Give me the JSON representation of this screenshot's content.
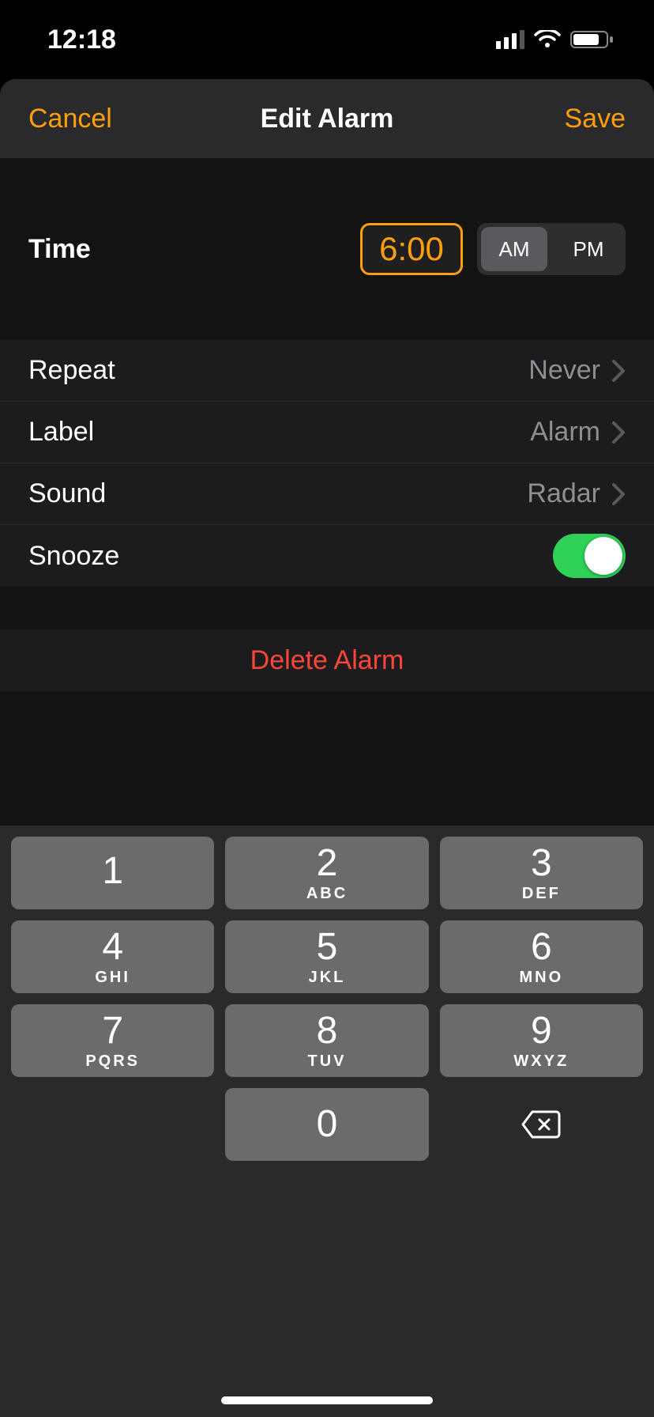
{
  "status": {
    "time": "12:18"
  },
  "nav": {
    "cancel": "Cancel",
    "title": "Edit Alarm",
    "save": "Save"
  },
  "time": {
    "label": "Time",
    "value": "6:00",
    "am": "AM",
    "pm": "PM",
    "selected": "AM"
  },
  "rows": {
    "repeat": {
      "label": "Repeat",
      "value": "Never"
    },
    "label": {
      "label": "Label",
      "value": "Alarm"
    },
    "sound": {
      "label": "Sound",
      "value": "Radar"
    },
    "snooze": {
      "label": "Snooze",
      "on": true
    }
  },
  "delete": {
    "label": "Delete Alarm"
  },
  "keypad": [
    {
      "d": "1",
      "l": " "
    },
    {
      "d": "2",
      "l": "ABC"
    },
    {
      "d": "3",
      "l": "DEF"
    },
    {
      "d": "4",
      "l": "GHI"
    },
    {
      "d": "5",
      "l": "JKL"
    },
    {
      "d": "6",
      "l": "MNO"
    },
    {
      "d": "7",
      "l": "PQRS"
    },
    {
      "d": "8",
      "l": "TUV"
    },
    {
      "d": "9",
      "l": "WXYZ"
    },
    {
      "d": "0",
      "l": ""
    }
  ]
}
